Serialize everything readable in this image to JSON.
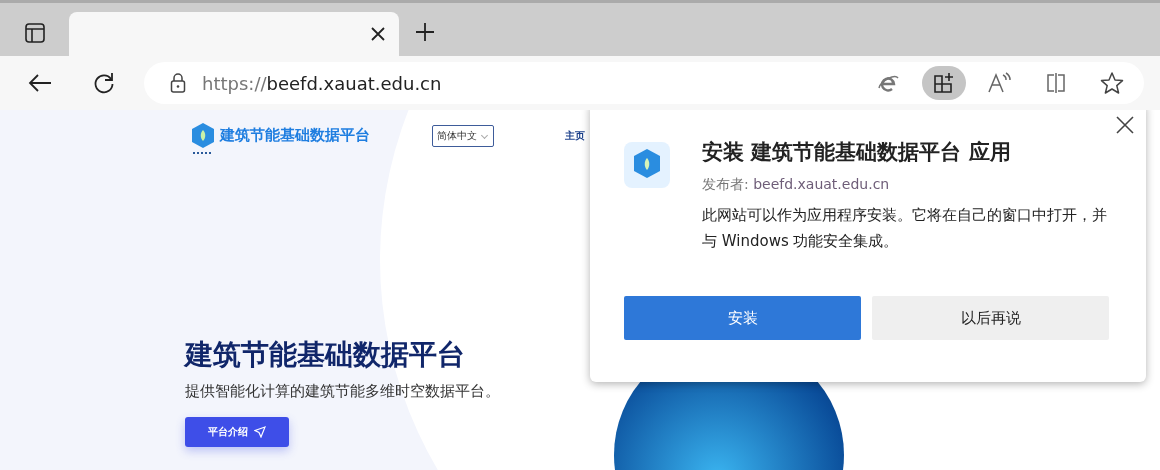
{
  "url": {
    "scheme": "https://",
    "host": "beefd.xauat.edu.cn"
  },
  "toolbar_buttons": [
    {
      "kind": "ie",
      "selected": false
    },
    {
      "kind": "apps",
      "selected": true
    },
    {
      "kind": "read",
      "selected": false
    },
    {
      "kind": "split",
      "selected": false
    },
    {
      "kind": "favorite",
      "selected": false
    }
  ],
  "site": {
    "logo_title": "建筑节能基础数据平台",
    "language": "简体中文",
    "nav": [
      "主页"
    ],
    "hero_title": "建筑节能基础数据平台",
    "hero_subtitle": "提供智能化计算的建筑节能多维时空数据平台。",
    "hero_button": "平台介绍"
  },
  "dialog": {
    "title": "安装 建筑节能基础数据平台 应用",
    "publisher_label": "发布者:",
    "publisher": "beefd.xauat.edu.cn",
    "message": "此网站可以作为应用程序安装。它将在自己的窗口中打开，并与 Windows 功能安全集成。",
    "buttons": [
      {
        "label": "安装",
        "kind": "primary"
      },
      {
        "label": "以后再说",
        "kind": "secondary"
      }
    ]
  }
}
